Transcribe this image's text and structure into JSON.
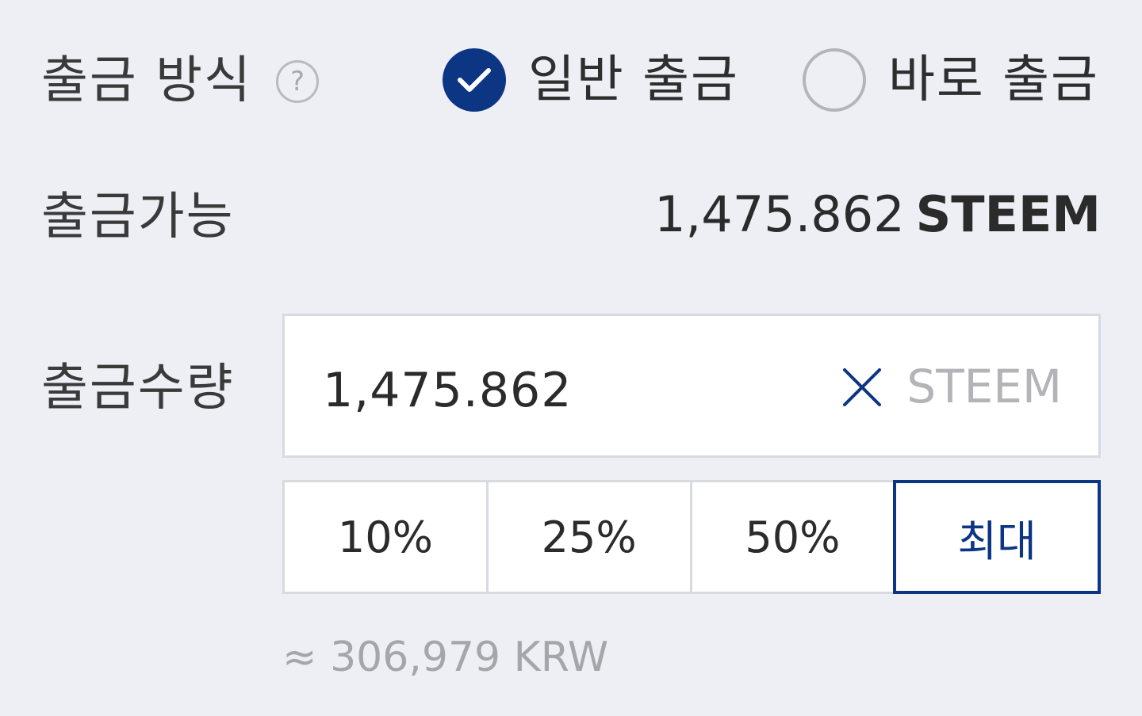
{
  "withdraw_method": {
    "label": "출금 방식",
    "help_icon": "?",
    "options": [
      {
        "label": "일반 출금",
        "selected": true
      },
      {
        "label": "바로 출금",
        "selected": false
      }
    ]
  },
  "available": {
    "label": "출금가능",
    "amount": "1,475.862",
    "unit": "STEEM"
  },
  "amount": {
    "label": "출금수량",
    "value": "1,475.862",
    "unit": "STEEM"
  },
  "percent_buttons": [
    {
      "label": "10%",
      "active": false
    },
    {
      "label": "25%",
      "active": false
    },
    {
      "label": "50%",
      "active": false
    },
    {
      "label": "최대",
      "active": true
    }
  ],
  "krw_estimate": "≈ 306,979 KRW",
  "colors": {
    "accent": "#0c3583",
    "background": "#eeeff5",
    "muted_text": "#a6a6aa",
    "border": "#d9dae0"
  }
}
